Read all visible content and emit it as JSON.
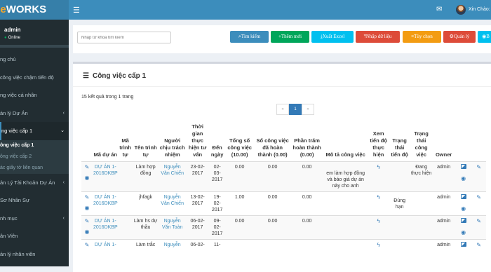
{
  "header": {
    "logo_part1": "ce",
    "logo_part2": "WORKS",
    "mail_badge": "",
    "greeting": "Xin Chào:"
  },
  "sidebar": {
    "username": "admin",
    "status": "Online",
    "items": [
      {
        "label": "ng chủ",
        "chevron": ""
      },
      {
        "label": " công việc chậm tiến độ",
        "chevron": ""
      },
      {
        "label": "ng việc cá nhân",
        "chevron": ""
      },
      {
        "label": "ản lý Dự Án",
        "chevron": "‹"
      },
      {
        "label": "ng việc cấp 1",
        "chevron": "⌄"
      }
    ],
    "subitems": [
      "ông việc cấp 1",
      "ông việc cấp 2",
      "ác giấy tờ liên quan"
    ],
    "items_after": [
      {
        "label": "ản Lý Tài Khoản Dự Án",
        "chevron": "‹"
      },
      {
        "label": " Sơ Nhân Sự",
        "chevron": ""
      },
      {
        "label": "nh mục",
        "chevron": "‹"
      },
      {
        "label": "ân Viên",
        "chevron": ""
      },
      {
        "label": "ản lý nhân viên",
        "chevron": ""
      }
    ]
  },
  "toolbar": {
    "search_placeholder": "Nhập từ khóa tìm kiếm",
    "buttons": [
      {
        "label": "Tìm kiếm",
        "icon": "search-icon",
        "color": "#3c8dbc"
      },
      {
        "label": "Thêm mới",
        "icon": "plus-icon",
        "color": "#00a65a"
      },
      {
        "label": "Xuất Excel",
        "icon": "download-icon",
        "color": "#00c0ef"
      },
      {
        "label": "Nhập dữ liệu",
        "icon": "upload-icon",
        "color": "#dd4b39"
      },
      {
        "label": "Tùy chọn",
        "icon": "list-icon",
        "color": "#f39c12"
      },
      {
        "label": "Quản lý",
        "icon": "gear-icon",
        "color": "#dd4b39"
      },
      {
        "label": "B",
        "icon": "circle-icon",
        "color": "#00c0ef"
      }
    ]
  },
  "box": {
    "title": "Công việc cấp 1",
    "result_count": "15 kết quả trong 1 trang",
    "pager": [
      "«",
      "1",
      "»"
    ]
  },
  "table": {
    "headers": [
      "",
      "Mã dự án",
      "Mã trình tự",
      "Tên trình tự",
      "Người chịu trách nhiệm",
      "Thời gian thực hiện tư vấn",
      "Đến ngày",
      "Tổng số công việc (10.00)",
      "Số công việc đã hoàn thành (0.00)",
      "Phần trăm hoàn thành (0.00)",
      "Mô tả công việc",
      "Xem tiến độ thực hiện",
      "Trạng thái tiến độ",
      "Trạng thái công việc",
      "Owner",
      "",
      ""
    ],
    "rows": [
      {
        "project": "DỰ ÁN 1-2016DKBP",
        "seq_code": "",
        "seq_name": "Làm hợp đồng",
        "owner_person": "Nguyễn Văn Chiến",
        "start": "23-02-2017",
        "end": "02-03-2017",
        "total": "0.00",
        "done": "0.00",
        "percent": "0.00",
        "desc": "em làm hợp đồng và báo giá dự án này cho anh",
        "progress_status": "",
        "work_status": "Đang thực hiện",
        "owner": "admin"
      },
      {
        "project": "DỰ ÁN 1-2016DKBP",
        "seq_code": "",
        "seq_name": "jhfagk",
        "owner_person": "Nguyễn Văn Chiến",
        "start": "13-02-2017",
        "end": "19-02-2017",
        "total": "1.00",
        "done": "0.00",
        "percent": "0.00",
        "desc": "",
        "progress_status": "Đúng hạn",
        "work_status": "",
        "owner": "admin"
      },
      {
        "project": "DỰ ÁN 1-2016DKBP",
        "seq_code": "",
        "seq_name": "Làm hs dự thầu",
        "owner_person": "Nguyễn Văn Toàn",
        "start": "06-02-2017",
        "end": "09-02-2017",
        "total": "0.00",
        "done": "0.00",
        "percent": "0.00",
        "desc": "",
        "progress_status": "",
        "work_status": "",
        "owner": "admin"
      },
      {
        "project": "DỰ ÁN 1-",
        "seq_code": "",
        "seq_name": "Làm trắc",
        "owner_person": "Nguyễn",
        "start": "06-02-",
        "end": "11-",
        "total": "",
        "done": "",
        "percent": "",
        "desc": "",
        "progress_status": "",
        "work_status": "",
        "owner": "admin"
      }
    ]
  }
}
